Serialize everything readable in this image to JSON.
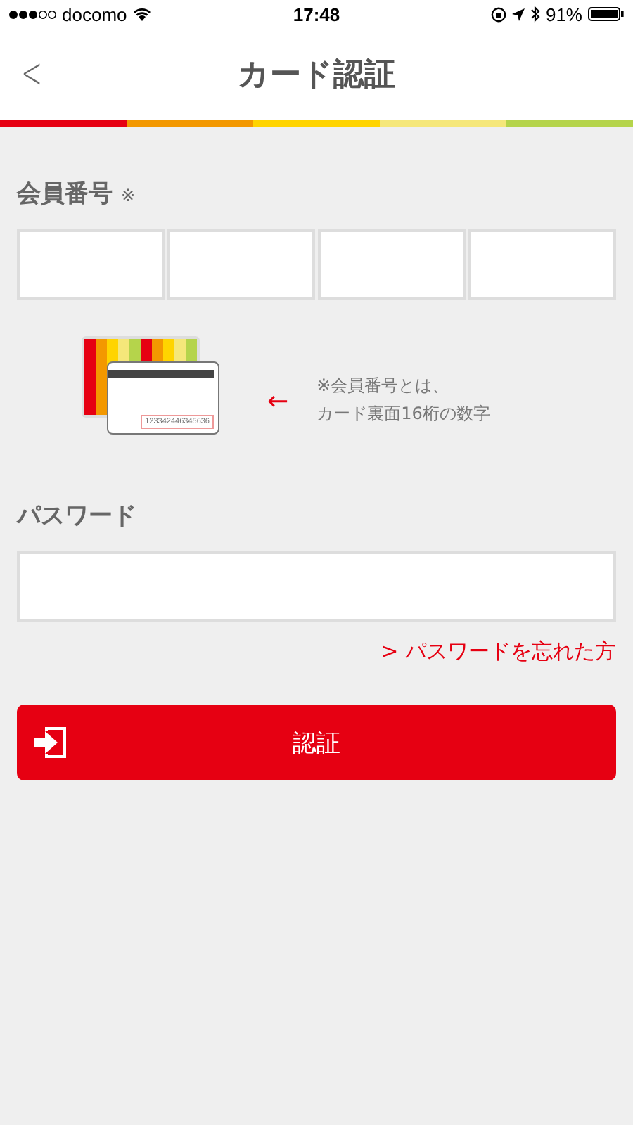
{
  "status_bar": {
    "carrier": "docomo",
    "time": "17:48",
    "battery": "91%"
  },
  "header": {
    "back": "<",
    "title": "カード認証"
  },
  "member_number": {
    "label": "会員番号",
    "required_mark": "※",
    "fields": [
      {
        "kind": "input"
      },
      {
        "kind": "input"
      },
      {
        "kind": "input"
      },
      {
        "kind": "input"
      }
    ]
  },
  "card_hint": {
    "card_number": "123342446345636",
    "arrow": "←",
    "note_lines": [
      "※会員番号とは、",
      "カード裏面16桁の数字"
    ]
  },
  "password": {
    "label": "パスワード"
  },
  "forgot_link": "> パスワードを忘れた方",
  "submit_button": "認証"
}
